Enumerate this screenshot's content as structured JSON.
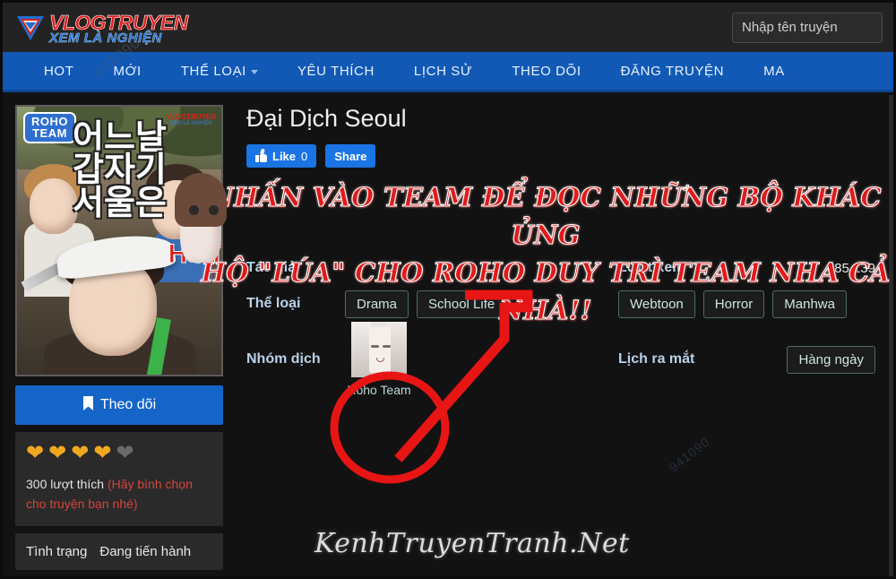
{
  "site": {
    "logo_main": "VLOGTRUYEN",
    "logo_sub": "XEM LÀ NGHIỆN",
    "logo_mark_icon": "triangle-logo-icon"
  },
  "search": {
    "placeholder": "Nhập tên truyện",
    "value": ""
  },
  "nav": {
    "items": [
      {
        "label": "HOT",
        "has_caret": false
      },
      {
        "label": "MỚI",
        "has_caret": false
      },
      {
        "label": "THỂ LOẠI",
        "has_caret": true
      },
      {
        "label": "YÊU THÍCH",
        "has_caret": false
      },
      {
        "label": "LỊCH SỬ",
        "has_caret": false
      },
      {
        "label": "THEO DÕI",
        "has_caret": false
      },
      {
        "label": "ĐĂNG TRUYỆN",
        "has_caret": false
      },
      {
        "label": "MA",
        "has_caret": false
      }
    ]
  },
  "cover": {
    "team_badge_line1": "ROHO",
    "team_badge_line2": "TEAM",
    "korean_title_line1": "어느날",
    "korean_title_line2": "갑자기",
    "korean_title_line3": "서울은",
    "corner_logo_main": "VLOGTRUYEN",
    "corner_logo_sub": "XEM LÀ NGHIỆN",
    "hot_label": "HOT"
  },
  "sidebar": {
    "follow_label": "Theo dõi",
    "follow_icon": "bookmark-icon",
    "hearts_filled": 4,
    "hearts_total": 5,
    "likes_text": "300 lượt thích",
    "likes_note": "(Hãy bình chọn cho truyện bạn nhé)",
    "status_label": "Tình trạng",
    "status_value": "Đang tiến hành"
  },
  "main": {
    "title": "Đại Dịch Seoul",
    "like_label": "Like",
    "like_count": "0",
    "share_label": "Share",
    "author_label": "Tác giả",
    "author_value": "",
    "views_label": "Lượt xem",
    "views_value": "385,139",
    "genre_label": "Thể loại",
    "genres": [
      "Drama",
      "School Life",
      "Webtoon",
      "Horror",
      "Manhwa"
    ],
    "team_label": "Nhóm dịch",
    "team_name": "Roho Team",
    "schedule_label": "Lịch ra mắt",
    "schedule_value": "Hàng ngày"
  },
  "overlay": {
    "banner_line1": "NHẤN VÀO TEAM ĐỂ ĐỌC NHỮNG BỘ KHÁC ỦNG",
    "banner_line2": "HỘ \"LÚA\" CHO ROHO DUY TRÌ TEAM NHA CẢ NHÀ!!",
    "watermark_script": "KenhTruyenTranh.Net",
    "watermark_diagonal": "941090",
    "annotation_arrow_icon": "red-arrow-annotation-icon",
    "annotation_circle_icon": "red-circle-annotation-icon"
  },
  "colors": {
    "nav_blue": "#1159b5",
    "accent_red": "#e01b1b",
    "label_blue": "#b9d2ea",
    "heart_gold": "#f0a81e",
    "page_bg": "#121212"
  }
}
